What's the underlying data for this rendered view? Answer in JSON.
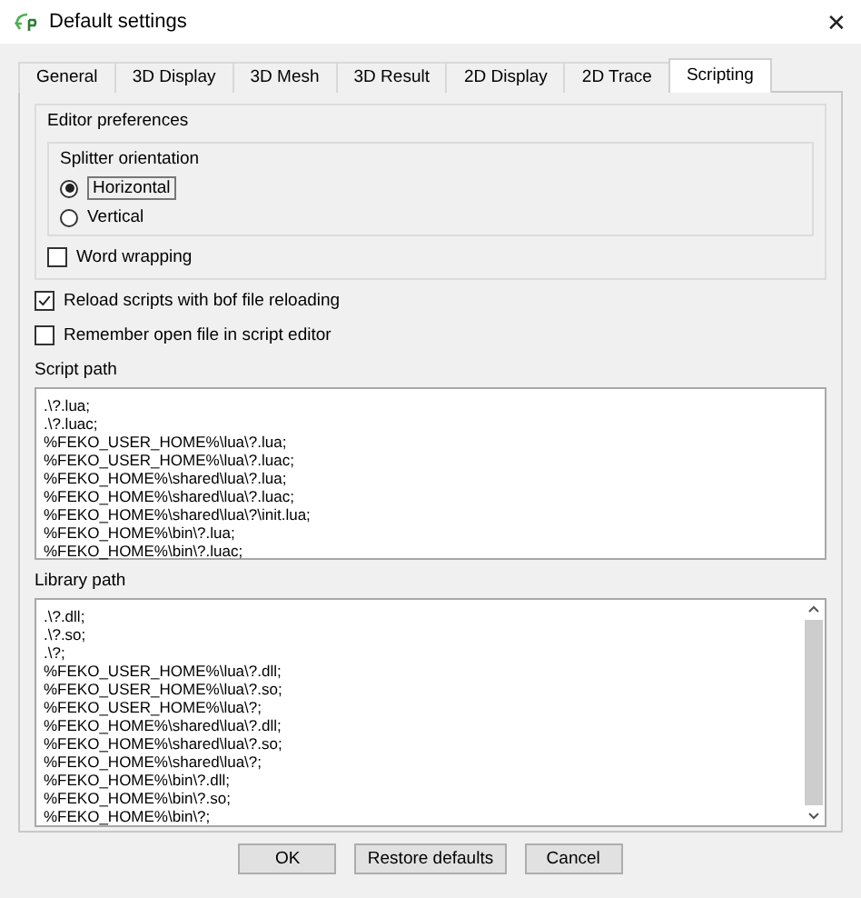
{
  "window": {
    "title": "Default settings",
    "close": "✕"
  },
  "tabs": [
    {
      "label": "General",
      "selected": false
    },
    {
      "label": "3D Display",
      "selected": false
    },
    {
      "label": "3D Mesh",
      "selected": false
    },
    {
      "label": "3D Result",
      "selected": false
    },
    {
      "label": "2D Display",
      "selected": false
    },
    {
      "label": "2D Trace",
      "selected": false
    },
    {
      "label": "Scripting",
      "selected": true
    }
  ],
  "editor_preferences": {
    "title": "Editor preferences",
    "splitter_orientation": {
      "title": "Splitter orientation",
      "options": [
        {
          "label": "Horizontal",
          "selected": true
        },
        {
          "label": "Vertical",
          "selected": false
        }
      ]
    },
    "word_wrapping": {
      "label": "Word wrapping",
      "checked": false
    }
  },
  "options": [
    {
      "label": "Reload scripts with bof file reloading",
      "checked": true
    },
    {
      "label": "Remember open file in script editor",
      "checked": false
    }
  ],
  "script_path": {
    "label": "Script path",
    "lines": [
      ".\\?.lua;",
      ".\\?.luac;",
      "%FEKO_USER_HOME%\\lua\\?.lua;",
      "%FEKO_USER_HOME%\\lua\\?.luac;",
      "%FEKO_HOME%\\shared\\lua\\?.lua;",
      "%FEKO_HOME%\\shared\\lua\\?.luac;",
      "%FEKO_HOME%\\shared\\lua\\?\\init.lua;",
      "%FEKO_HOME%\\bin\\?.lua;",
      "%FEKO_HOME%\\bin\\?.luac;"
    ]
  },
  "library_path": {
    "label": "Library path",
    "lines": [
      ".\\?.dll;",
      ".\\?.so;",
      ".\\?;",
      "%FEKO_USER_HOME%\\lua\\?.dll;",
      "%FEKO_USER_HOME%\\lua\\?.so;",
      "%FEKO_USER_HOME%\\lua\\?;",
      "%FEKO_HOME%\\shared\\lua\\?.dll;",
      "%FEKO_HOME%\\shared\\lua\\?.so;",
      "%FEKO_HOME%\\shared\\lua\\?;",
      "%FEKO_HOME%\\bin\\?.dll;",
      "%FEKO_HOME%\\bin\\?.so;",
      "%FEKO_HOME%\\bin\\?;"
    ]
  },
  "buttons": [
    "OK",
    "Restore defaults",
    "Cancel"
  ]
}
